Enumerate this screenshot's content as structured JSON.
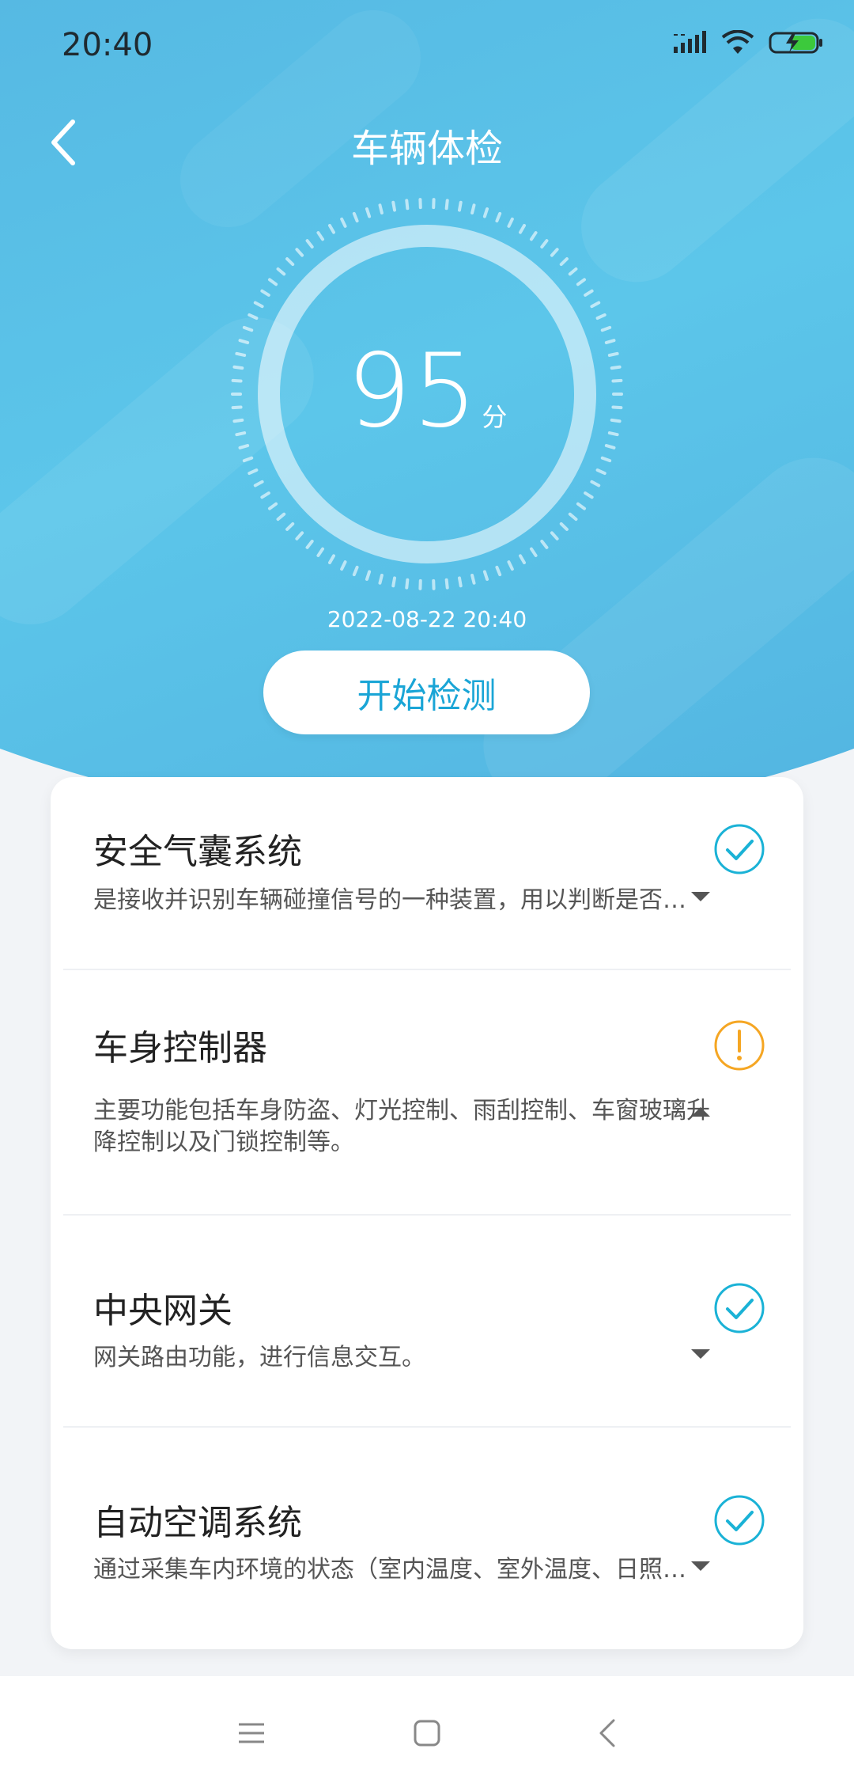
{
  "status_bar": {
    "time": "20:40",
    "icons": [
      "signal-icon",
      "wifi-icon",
      "battery-charging-icon"
    ]
  },
  "header": {
    "title": "车辆体检",
    "back_icon": "chevron-left-icon"
  },
  "score": {
    "value": "95",
    "unit": "分",
    "ring_level": 0.95
  },
  "check_time": "2022-08-22 20:40",
  "start_button": "开始检测",
  "colors": {
    "accent": "#1aa5d6",
    "ok": "#1ab2d6",
    "warning": "#f5a623",
    "hero_start": "#56b9e3",
    "hero_end": "#52b3e0"
  },
  "items": [
    {
      "title": "安全气囊系统",
      "desc": "是接收并识别车辆碰撞信号的一种装置，用以判断是否需要展开安全气囊的系统。",
      "status": "ok",
      "status_icon": "check-circle-icon",
      "expanded": false
    },
    {
      "title": "车身控制器",
      "desc": "主要功能包括车身防盗、灯光控制、雨刮控制、车窗玻璃升降控制以及门锁控制等。",
      "status": "warning",
      "status_icon": "warning-circle-icon",
      "expanded": true
    },
    {
      "title": "中央网关",
      "desc": "网关路由功能，进行信息交互。",
      "status": "ok",
      "status_icon": "check-circle-icon",
      "expanded": false
    },
    {
      "title": "自动空调系统",
      "desc": "通过采集车内环境的状态（室内温度、室外温度、日照强度等）自动调节空调的系统。",
      "status": "ok",
      "status_icon": "check-circle-icon",
      "expanded": false
    }
  ],
  "nav_bar": {
    "icons": [
      "menu-icon",
      "home-square-icon",
      "back-triangle-icon"
    ]
  }
}
